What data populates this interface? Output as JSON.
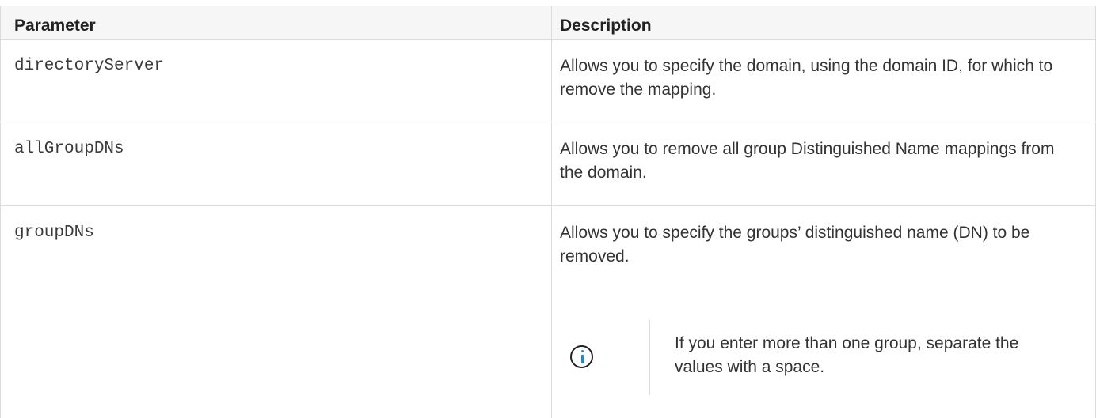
{
  "table": {
    "headers": {
      "parameter": "Parameter",
      "description": "Description"
    },
    "rows": [
      {
        "parameter": "directoryServer",
        "description": "Allows you to specify the domain, using the domain ID, for which to remove the mapping."
      },
      {
        "parameter": "allGroupDNs",
        "description": "Allows you to remove all group Distinguished Name mappings from the domain."
      },
      {
        "parameter": "groupDNs",
        "description": "Allows you to specify the groups’ distinguished name (DN) to be removed.",
        "note": {
          "icon": "info-icon",
          "text": "If you enter more than one group, separate the values with a space."
        }
      }
    ]
  },
  "colors": {
    "border": "#dcdcdc",
    "header_bg": "#f6f6f6",
    "info_accent": "#1a8ad4"
  }
}
